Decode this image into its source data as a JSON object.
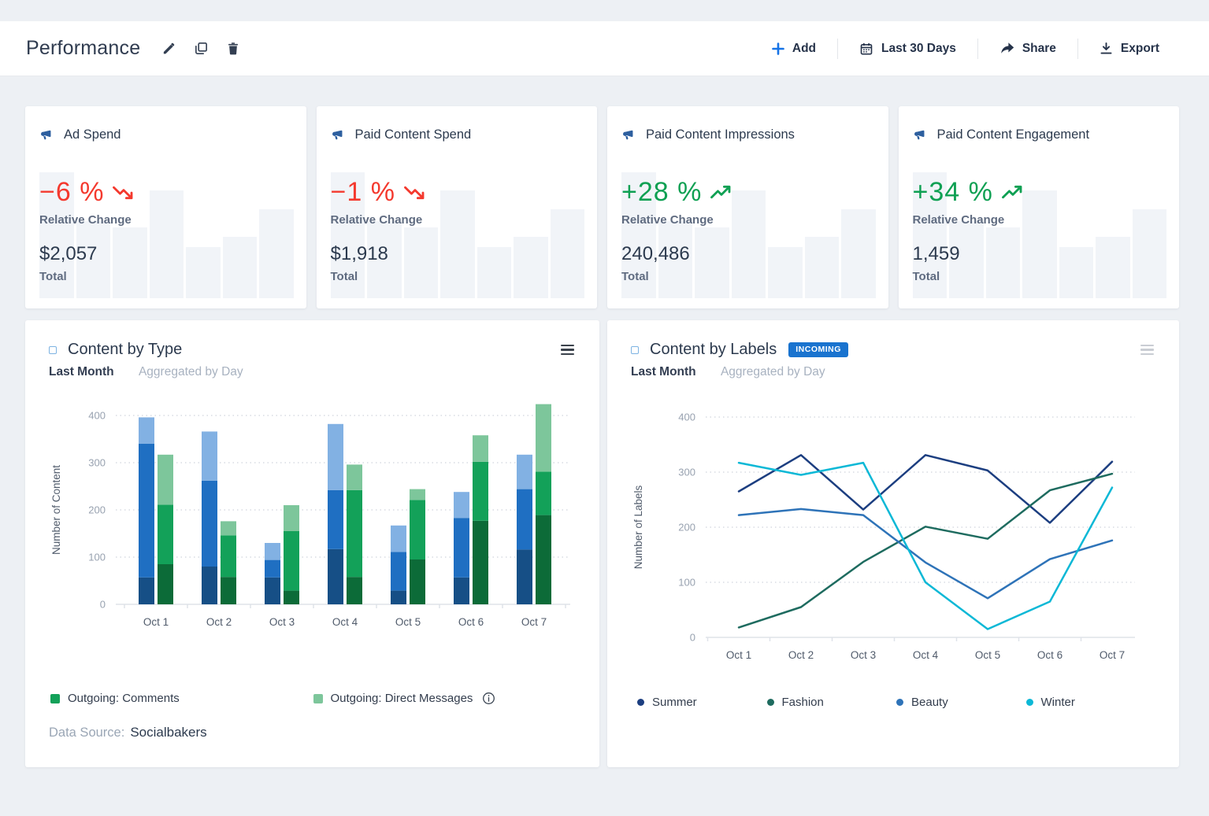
{
  "header": {
    "title": "Performance",
    "actions": [
      {
        "label": "Add",
        "icon": "plus-icon"
      },
      {
        "label": "Last 30 Days",
        "icon": "calendar-icon"
      },
      {
        "label": "Share",
        "icon": "share-icon"
      },
      {
        "label": "Export",
        "icon": "export-icon"
      }
    ]
  },
  "colors": {
    "positive": "#0fa053",
    "negative": "#f4392e",
    "accent_blue": "#1673e6",
    "badge_blue": "#1973cf",
    "megaphone_blue": "#2d5f9f",
    "sparkline_bar": "#f1f4f8"
  },
  "kpi_sparkline": [
    100,
    61.5,
    56,
    85.5,
    40.5,
    48.5,
    70.5
  ],
  "kpi_cards": [
    {
      "title": "Ad Spend",
      "change": "−6 %",
      "direction": "down",
      "change_label": "Relative Change",
      "value": "$2,057",
      "value_label": "Total"
    },
    {
      "title": "Paid Content Spend",
      "change": "−1 %",
      "direction": "down",
      "change_label": "Relative Change",
      "value": "$1,918",
      "value_label": "Total"
    },
    {
      "title": "Paid Content Impressions",
      "change": "+28 %",
      "direction": "up",
      "change_label": "Relative Change",
      "value": "240,486",
      "value_label": "Total"
    },
    {
      "title": "Paid Content Engagement",
      "change": "+34 %",
      "direction": "up",
      "change_label": "Relative Change",
      "value": "1,459",
      "value_label": "Total"
    }
  ],
  "chart_data": [
    {
      "id": "content-by-type",
      "type": "bar",
      "title": "Content by Type",
      "period": "Last Month",
      "aggregation": "Aggregated by Day",
      "ylabel": "Number of Content",
      "ylim": [
        0,
        400
      ],
      "yticks": [
        0,
        100,
        200,
        300,
        400
      ],
      "grid": "dotted-horizontal",
      "categories": [
        "Oct 1",
        "Oct 2",
        "Oct 3",
        "Oct 4",
        "Oct 5",
        "Oct 6",
        "Oct 7"
      ],
      "groups": [
        {
          "name": "blue-stack",
          "colors": [
            "#164f86",
            "#1f6fc2",
            "#82b1e3"
          ],
          "segments": [
            [
              57,
              283,
              56
            ],
            [
              80,
              182,
              104
            ],
            [
              57,
              37,
              36
            ],
            [
              117,
              125,
              140
            ],
            [
              29,
              82,
              56
            ],
            [
              57,
              126,
              55
            ],
            [
              116,
              128,
              73
            ]
          ]
        },
        {
          "name": "green-stack",
          "colors": [
            "#0c6b38",
            "#13a159",
            "#7dc69b"
          ],
          "segments": [
            [
              85,
              126,
              106
            ],
            [
              58,
              88,
              30
            ],
            [
              29,
              126,
              55
            ],
            [
              58,
              184,
              54
            ],
            [
              95,
              126,
              23
            ],
            [
              177,
              125,
              56
            ],
            [
              189,
              92,
              143
            ]
          ]
        }
      ],
      "legend": [
        {
          "label": "Outgoing: Comments",
          "color": "#13a159",
          "info": false
        },
        {
          "label": "Outgoing: Direct Messages",
          "color": "#7dc69b",
          "info": true
        }
      ],
      "data_source_label": "Data Source:",
      "data_source": "Socialbakers"
    },
    {
      "id": "content-by-labels",
      "type": "line",
      "title": "Content by Labels",
      "badge": "INCOMING",
      "period": "Last Month",
      "aggregation": "Aggregated by Day",
      "ylabel": "Number of Labels",
      "ylim": [
        0,
        400
      ],
      "yticks": [
        0,
        100,
        200,
        300,
        400
      ],
      "grid": "dotted-horizontal",
      "legend_position": "bottom",
      "categories": [
        "Oct 1",
        "Oct 2",
        "Oct 3",
        "Oct 4",
        "Oct 5",
        "Oct 6",
        "Oct 7"
      ],
      "series": [
        {
          "name": "Summer",
          "color": "#1c3e80",
          "values": [
            265,
            331,
            232,
            331,
            303,
            208,
            319
          ]
        },
        {
          "name": "Fashion",
          "color": "#1e6b5f",
          "values": [
            18,
            55,
            137,
            201,
            179,
            267,
            297
          ]
        },
        {
          "name": "Beauty",
          "color": "#2e73b8",
          "values": [
            222,
            233,
            222,
            136,
            71,
            142,
            176
          ]
        },
        {
          "name": "Winter",
          "color": "#0cb8d6",
          "values": [
            317,
            295,
            317,
            100,
            15,
            65,
            272
          ]
        }
      ]
    }
  ]
}
